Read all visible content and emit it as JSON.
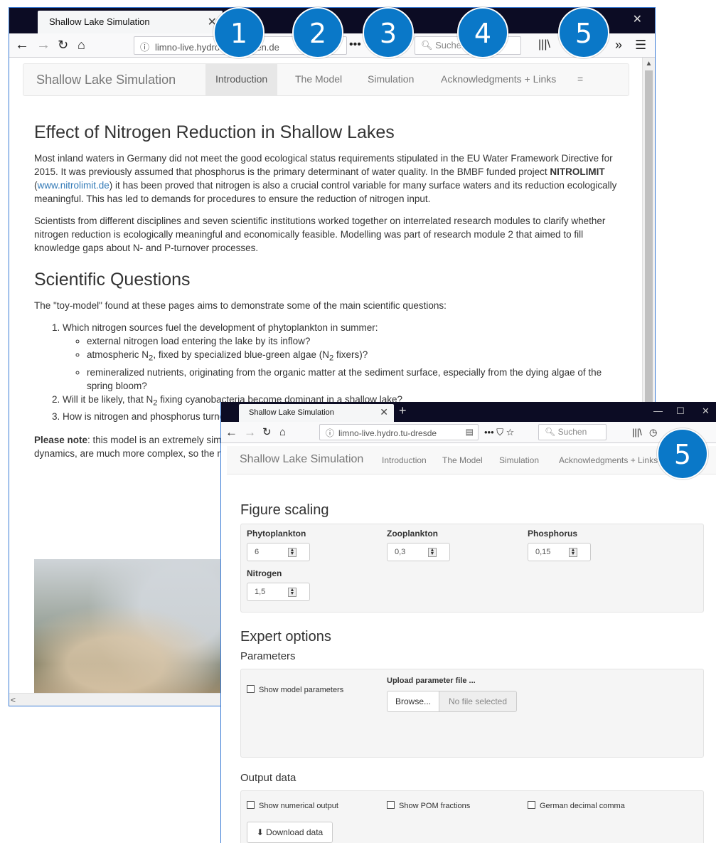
{
  "window1": {
    "tab_title": "Shallow Lake Simulation",
    "url": "limno-live.hydro.tu-dresden.de",
    "search_placeholder": "Suchen",
    "app": {
      "brand": "Shallow Lake Simulation",
      "nav": [
        "Introduction",
        "The Model",
        "Simulation",
        "Acknowledgments + Links",
        "="
      ],
      "active_nav": "Introduction"
    },
    "content": {
      "h_effect": "Effect of Nitrogen Reduction in Shallow Lakes",
      "p1_a": "Most inland waters in Germany did not meet the good ecological status requirements stipulated in the EU Water Framework Directive for 2015. It was previously assumed that phosphorus is the primary determinant of water quality. In the BMBF funded project ",
      "p1_bold": "NITROLIMIT",
      "p1_link": "www.nitrolimit.de",
      "p1_b": ") it has been proved that nitrogen is also a crucial control variable for many surface waters and its reduction ecologically meaningful. This has led to demands for procedures to ensure the reduction of nitrogen input.",
      "p2": "Scientists from different disciplines and seven scientific institutions worked together on interrelated research modules to clarify whether nitrogen reduction is ecologically meaningful and economically feasible. Modelling was part of research module 2 that aimed to fill knowledge gaps about N- and P-turnover processes.",
      "h_questions": "Scientific Questions",
      "p3": "The \"toy-model\" found at these pages aims to demonstrate some of the main scientific questions:",
      "q1": "Which nitrogen sources fuel the development of phytoplankton in summer:",
      "q1_sub1": "external nitrogen load entering the lake by its inflow?",
      "q1_sub2_a": "atmospheric N",
      "q1_sub2_b": ", fixed by specialized blue-green algae (N",
      "q1_sub2_c": " fixers)?",
      "q1_sub3": "remineralized nutrients, originating from the organic matter at the sediment surface, especially from the dying algae of the spring bloom?",
      "q2_a": "Will it be likely, that N",
      "q2_b": " fixing cyanobacteria become dominant in a shallow lake?",
      "q3": "How is nitrogen and phosphorus turnover influenced by physical and biological processes?",
      "note_bold": "Please note",
      "note": ": this model is an extremely simplified representation of shallow lake ecosystems. Real-world processes, and especially their dynamics, are much more complex, so the model can not be used for any predictions."
    }
  },
  "window2": {
    "tab_title": "Shallow Lake Simulation",
    "url": "limno-live.hydro.tu-dresde",
    "search_placeholder": "Suchen",
    "app": {
      "brand": "Shallow Lake Simulation",
      "nav": [
        "Introduction",
        "The Model",
        "Simulation",
        "Acknowledgments + Links"
      ]
    },
    "figure_scaling": {
      "heading": "Figure scaling",
      "fields": [
        {
          "label": "Phytoplankton",
          "value": "6"
        },
        {
          "label": "Zooplankton",
          "value": "0,3"
        },
        {
          "label": "Phosphorus",
          "value": "0,15"
        },
        {
          "label": "Nitrogen",
          "value": "1,5"
        }
      ]
    },
    "expert": {
      "heading": "Expert options",
      "parameters_heading": "Parameters",
      "show_model_params": "Show model parameters",
      "upload_label": "Upload parameter file ...",
      "browse": "Browse...",
      "no_file": "No file selected",
      "output_heading": "Output data",
      "show_numerical": "Show numerical output",
      "show_pom": "Show POM fractions",
      "german_comma": "German decimal comma",
      "download": "Download data"
    }
  },
  "callouts": [
    "1",
    "2",
    "3",
    "4",
    "5",
    "5"
  ],
  "colors": {
    "callout": "#0a78c8",
    "titlebar": "#0c0c24",
    "link": "#337ab7"
  }
}
